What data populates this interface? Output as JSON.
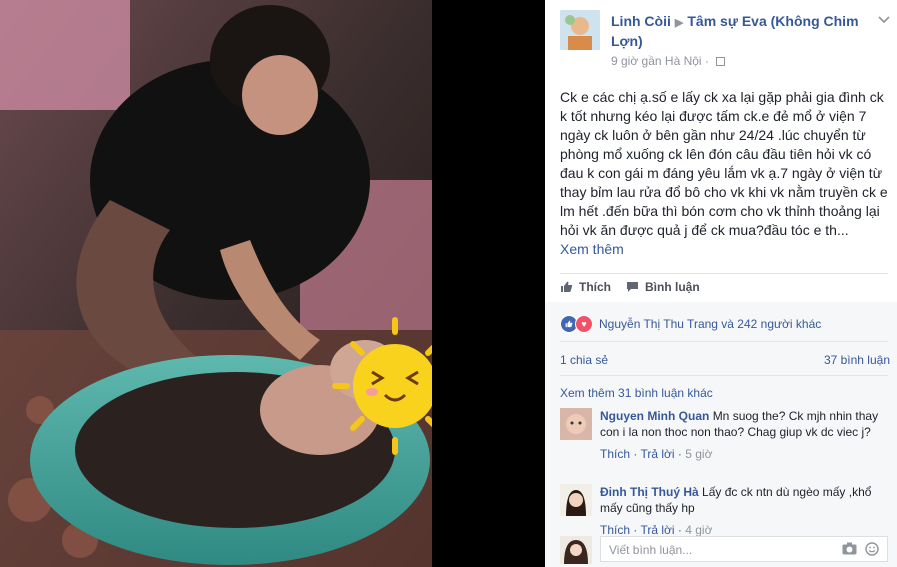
{
  "post": {
    "author": "Linh Còii",
    "group": "Tâm sự Eva (Không Chim Lợn)",
    "meta": "9 giờ gần Hà Nội ·",
    "body": "Ck e các chị ạ.số e lấy ck xa lại gặp phải gia đình ck k tốt nhưng kéo lại được tấm ck.e đẻ mổ ở viện 7 ngày ck luôn ở bên gần như 24/24 .lúc chuyển từ phòng mổ xuống ck lên đón câu đầu tiên hỏi vk có đau k con gái m đáng yêu lắm vk ạ.7 ngày ở viện từ thay bỉm lau rửa đổ bô cho vk khi vk nằm truyền ck e lm hết .đến bữa thì bón cơm cho vk thỉnh thoảng lại hỏi vk ăn được quả j để ck mua?đầu tóc e th...",
    "see_more": "Xem thêm"
  },
  "actions": {
    "like": "Thích",
    "comment": "Bình luận"
  },
  "reactions": {
    "text": "Nguyễn Thị Thu Trang và 242 người khác",
    "shares": "1 chia sẻ",
    "comments_count": "37 bình luận"
  },
  "comments": {
    "see_more": "Xem thêm 31 bình luận khác",
    "items": [
      {
        "name": "Nguyen Minh Quan",
        "text": "Mn suog the? Ck mjh nhin thay con i la non thoc non thao? Chag giup vk dc viec j?",
        "like": "Thích",
        "reply": "Trả lời",
        "time": "5 giờ"
      },
      {
        "name": "Đinh Thị Thuý Hà",
        "text": "Lấy đc ck ntn dù ngèo mấy ,khổ mấy cũng thấy hp",
        "like": "Thích",
        "reply": "Trả lời",
        "time": "4 giờ"
      }
    ],
    "write_placeholder": "Viết bình luận..."
  },
  "icons": {
    "globe": "location-icon",
    "like": "thumb-up-icon",
    "comment": "comment-icon",
    "camera": "camera-icon",
    "sticker": "sticker-icon"
  },
  "colors": {
    "link": "#365899",
    "like_blue": "#4267b2",
    "love_red": "#f25268",
    "panel_bg": "#ffffff",
    "comments_bg": "#f6f7f9"
  }
}
